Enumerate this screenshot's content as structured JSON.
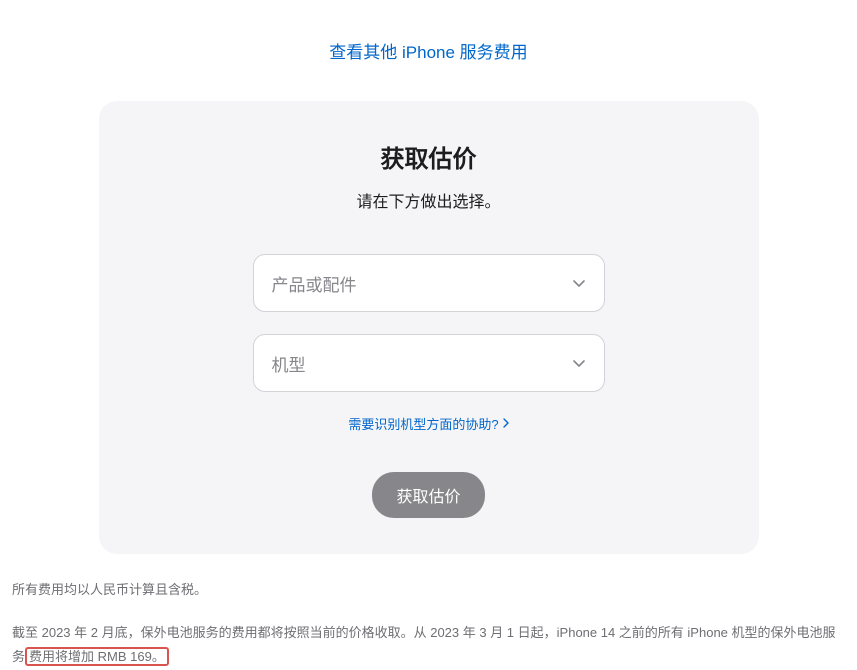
{
  "topLink": {
    "text": "查看其他 iPhone 服务费用"
  },
  "card": {
    "title": "获取估价",
    "subtitle": "请在下方做出选择。",
    "dropdown1": {
      "placeholder": "产品或配件"
    },
    "dropdown2": {
      "placeholder": "机型"
    },
    "helpLink": {
      "text": "需要识别机型方面的协助?"
    },
    "submitButton": {
      "label": "获取估价"
    }
  },
  "footer": {
    "line1": "所有费用均以人民币计算且含税。",
    "line2_part1": "截至 2023 年 2 月底，保外电池服务的费用都将按照当前的价格收取。从 2023 年 3 月 1 日起，iPhone 14 之前的所有 iPhone 机型的保外电池服务",
    "line2_highlight": "费用将增加 RMB 169。"
  }
}
